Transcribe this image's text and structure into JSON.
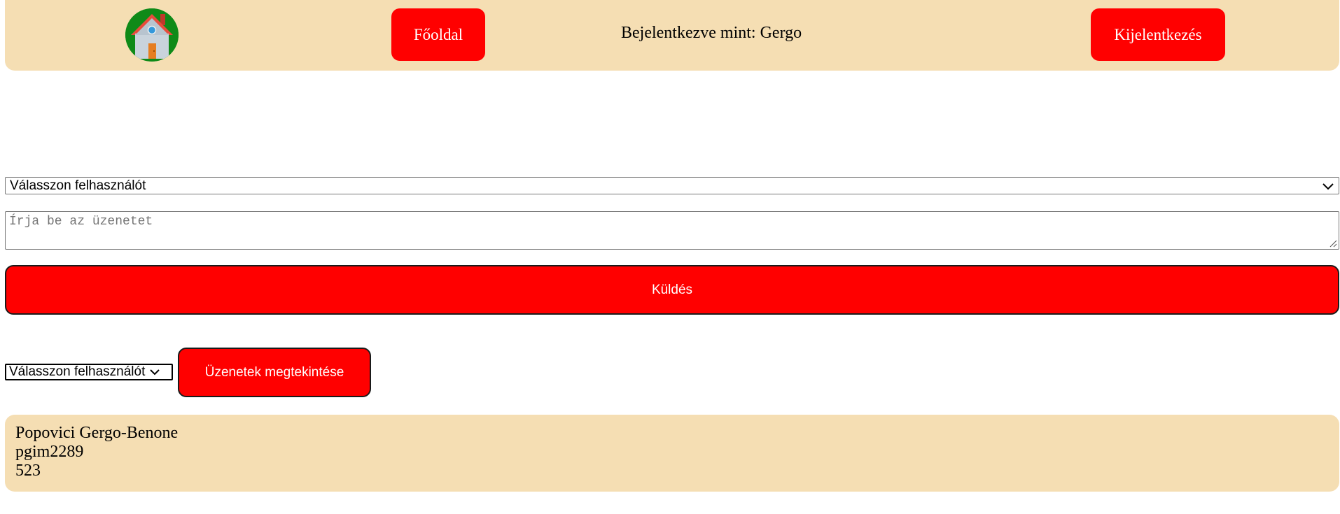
{
  "navbar": {
    "logo_icon": "house-icon",
    "home_label": "Főoldal",
    "login_status": "Bejelentkezve mint: Gergo",
    "logout_label": "Kijelentkezés",
    "background_color": "#f5deb3",
    "button_color": "#ff0000"
  },
  "compose": {
    "recipient_select": "Válasszon felhasználót",
    "message_placeholder": "Írja be az üzenetet",
    "message_value": "",
    "send_label": "Küldés"
  },
  "view": {
    "user_select": "Válasszon felhasználót",
    "view_label": "Üzenetek megtekintése"
  },
  "user_info": {
    "full_name": "Popovici Gergo-Benone",
    "username": "pgim2289",
    "number": "523"
  }
}
